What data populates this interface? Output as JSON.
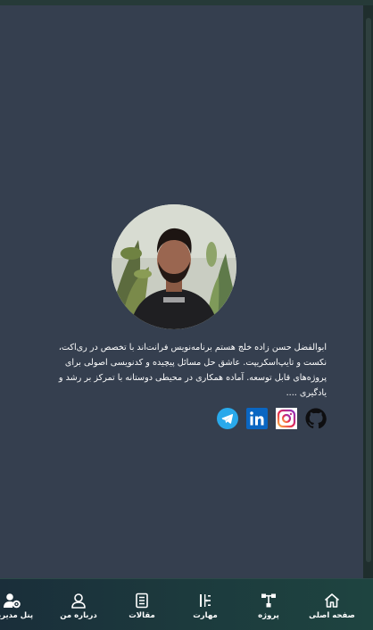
{
  "profile": {
    "bio": "ابوالفضل حسن زاده خلج هستم برنامه‌نویس فرانت‌اند با تخصص در ری‌اکت، نکست و تایپ‌اسکریپت. عاشق حل مسائل پیچیده و کدنویسی اصولی برای پروژه‌های قابل توسعه. آماده همکاری در محیطی دوستانه با تمرکز بر رشد و یادگیری ...."
  },
  "socials": [
    {
      "icon": "github-icon"
    },
    {
      "icon": "instagram-icon"
    },
    {
      "icon": "linkedin-icon"
    },
    {
      "icon": "telegram-icon"
    }
  ],
  "nav": {
    "home": "صفحه اصلی",
    "projects": "پروژه",
    "skills": "مهارت",
    "articles": "مقالات",
    "about": "درباره من",
    "admin": "پنل مدیریت"
  },
  "colors": {
    "background": "#353f4f",
    "nav_start": "#1a2e3a",
    "nav_end": "#1e4440",
    "linkedin": "#0a66c2",
    "telegram": "#29a9eb"
  }
}
